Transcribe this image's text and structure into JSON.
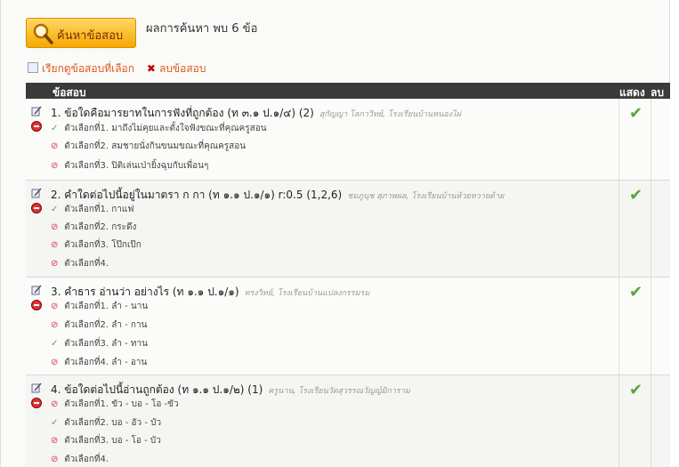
{
  "search": {
    "button_label": "ค้นหาข้อสอบ",
    "result_text": "ผลการค้นหา พบ 6 ข้อ"
  },
  "actions": {
    "view_selected": "เรียกดูข้อสอบที่เลือก",
    "delete": "ลบข้อสอบ"
  },
  "table": {
    "col_question": "ข้อสอบ",
    "col_show": "แสดง",
    "col_delete": "ลบ"
  },
  "questions": [
    {
      "title": "1. ข้อใดคือมารยาทในการฟังที่ถูกต้อง  (ท ๓.๑ ป.๑/๔) (2)",
      "meta": "สุกัญญา โลกาวิทย์, โรงเรียนบ้านหนองไผ่",
      "choices": [
        {
          "mark": "✓",
          "correct": true,
          "text": "ตัวเลือกที่1.  มาถึงไม่คุยและตั้งใจฟังขณะที่คุณครูสอน"
        },
        {
          "mark": "⊘",
          "correct": false,
          "text": "ตัวเลือกที่2.  สมชายนั่งกินขนมขณะที่คุณครูสอน"
        },
        {
          "mark": "⊘",
          "correct": false,
          "text": "ตัวเลือกที่3.  ปิติเล่นเป่ายิ้งฉุบกับเพื่อนๆ"
        }
      ],
      "show": "✔"
    },
    {
      "title": "2. คำใดต่อไปนี้อยู่ในมาตรา ก กา  (ท ๑.๑ ป.๑/๑) r:0.5 (1,2,6)",
      "meta": "ชมภูนุช สุภาพผล, โรงเรียนบ้านห้วยหวายด้าย",
      "choices": [
        {
          "mark": "✓",
          "correct": true,
          "text": "ตัวเลือกที่1.  กาแฟ"
        },
        {
          "mark": "⊘",
          "correct": false,
          "text": "ตัวเลือกที่2.  กระดึง"
        },
        {
          "mark": "⊘",
          "correct": false,
          "text": "ตัวเลือกที่3.  โป๊กเป๊ก"
        },
        {
          "mark": "⊘",
          "correct": false,
          "text": "ตัวเลือกที่4."
        }
      ],
      "show": "✔"
    },
    {
      "title": "3. คำธาร อ่านว่า อย่างไร  (ท ๑.๑ ป.๑/๑)",
      "meta": "ทรงวิทย์, โรงเรียนบ้านแปลงกรรมรม",
      "choices": [
        {
          "mark": "⊘",
          "correct": false,
          "text": "ตัวเลือกที่1.  ลำ - นาน"
        },
        {
          "mark": "⊘",
          "correct": false,
          "text": "ตัวเลือกที่2.  ลำ - กาน"
        },
        {
          "mark": "✓",
          "correct": true,
          "text": "ตัวเลือกที่3.  ลำ - ทาน"
        },
        {
          "mark": "⊘",
          "correct": false,
          "text": "ตัวเลือกที่4.  ลำ - อาน"
        }
      ],
      "show": "✔"
    },
    {
      "title": "4. ข้อใดต่อไปนี้อ่านถูกต้อง  (ท ๑.๑ ป.๑/๒) (1)",
      "meta": "ครูนาน, โรงเรียนวัดสุวรรณวัญญ์มิการาม",
      "choices": [
        {
          "mark": "⊘",
          "correct": false,
          "text": "ตัวเลือกที่1.  ขัว - บอ - โอ -ขัว"
        },
        {
          "mark": "✓",
          "correct": true,
          "text": "ตัวเลือกที่2.  บอ - อัว - บัว"
        },
        {
          "mark": "⊘",
          "correct": false,
          "text": "ตัวเลือกที่3.  บอ - โอ - บัว"
        },
        {
          "mark": "⊘",
          "correct": false,
          "text": "ตัวเลือกที่4."
        }
      ],
      "show": "✔"
    }
  ]
}
